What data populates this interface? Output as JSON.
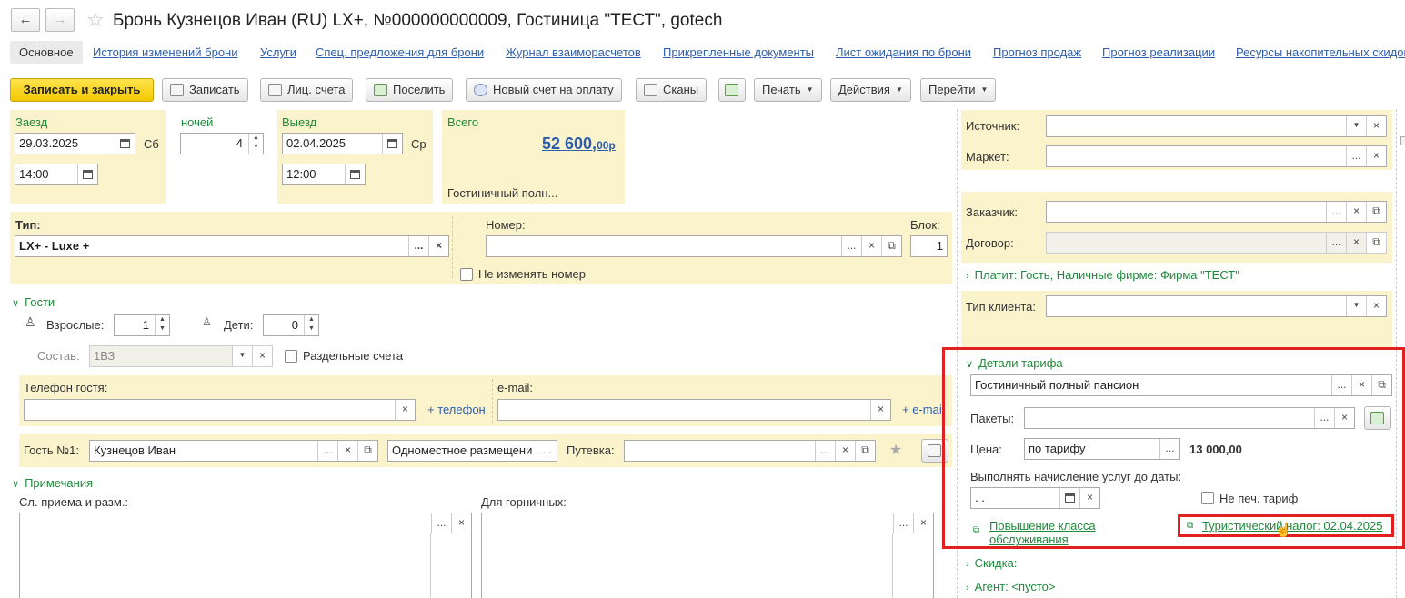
{
  "window": {
    "title": "Бронь Кузнецов Иван (RU) LX+, №000000000009, Гостиница \"ТЕСТ\", gotech",
    "back": "←",
    "forward": "→",
    "fav": "☆"
  },
  "tabs": [
    "Основное",
    "История изменений брони",
    "Услуги",
    "Спец. предложения для брони",
    "Журнал взаиморасчетов",
    "Прикрепленные документы",
    "Лист ожидания по брони",
    "Прогноз продаж",
    "Прогноз реализации",
    "Ресурсы накопительных скидок"
  ],
  "toolbar": {
    "save_close": "Записать и закрыть",
    "save": "Записать",
    "personal_account": "Лиц. счета",
    "check_in": "Поселить",
    "new_invoice": "Новый счет на оплату",
    "scans": "Сканы",
    "print": "Печать",
    "actions": "Действия",
    "goto": "Перейти"
  },
  "stay": {
    "arrival_label": "Заезд",
    "arrival_date": "29.03.2025",
    "arrival_dow": "Сб",
    "arrival_time": "14:00",
    "nights_label": "ночей",
    "nights": "4",
    "departure_label": "Выезд",
    "departure_date": "02.04.2025",
    "departure_dow": "Ср",
    "departure_time": "12:00",
    "total_label": "Всего",
    "total_main": "52 600,",
    "total_frac": "00р",
    "rate_short": "Гостиничный полн..."
  },
  "room": {
    "type_label": "Тип:",
    "type_value": "LX+ - Luxe +",
    "number_label": "Номер:",
    "block_label": "Блок:",
    "block_value": "1",
    "keep_number": "Не изменять номер"
  },
  "guests": {
    "header": "Гости",
    "adults_label": "Взрослые:",
    "adults": "1",
    "children_label": "Дети:",
    "children": "0",
    "comp_label": "Состав:",
    "comp_value": "1ВЗ",
    "separate_accounts": "Раздельные счета",
    "phone_label": "Телефон гостя:",
    "add_phone": "+ телефон",
    "email_label": "e-mail:",
    "add_email": "+ e-mail",
    "guest_label": "Гость №1:",
    "guest_name": "Кузнецов Иван",
    "accommodation": "Одноместное размещени",
    "voucher_label": "Путевка:"
  },
  "notes": {
    "header": "Примечания",
    "reception_label": "Сл. приема и разм.:",
    "maid_label": "Для горничных:"
  },
  "right": {
    "source_label": "Источник:",
    "market_label": "Маркет:",
    "customer_label": "Заказчик:",
    "contract_label": "Договор:",
    "payer": "Платит: Гость, Наличные фирме: Фирма \"ТЕСТ\"",
    "client_type_label": "Тип клиента:"
  },
  "tariff": {
    "header": "Детали тарифа",
    "name": "Гостиничный полный пансион",
    "packages_label": "Пакеты:",
    "price_label": "Цена:",
    "price_mode": "по тарифу",
    "price_value": "13 000,00",
    "accrue_label": "Выполнять начисление услуг до даты:",
    "accrue_date": " .  .",
    "no_print": "Не печ. тариф",
    "upgrade": "Повышение класса обслуживания",
    "tourist_tax": "Туристический налог: 02.04.2025"
  },
  "discount": "Скидка:",
  "agent": "Агент: <пусто>"
}
